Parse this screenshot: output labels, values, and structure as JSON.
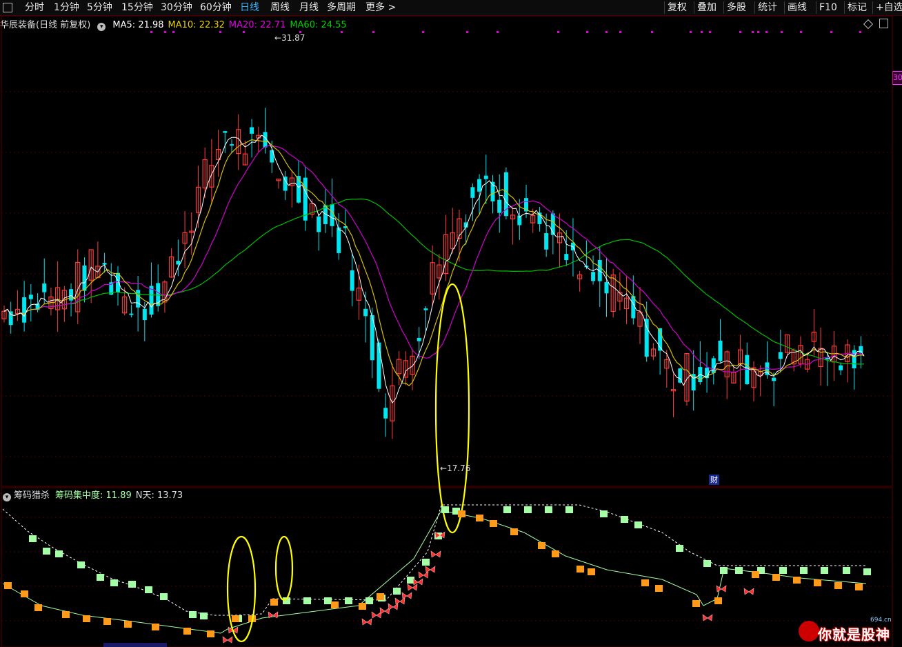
{
  "toolbar": {
    "left_items": [
      {
        "label": "分时",
        "active": false
      },
      {
        "label": "1分钟",
        "active": false
      },
      {
        "label": "5分钟",
        "active": false
      },
      {
        "label": "15分钟",
        "active": false
      },
      {
        "label": "30分钟",
        "active": false
      },
      {
        "label": "60分钟",
        "active": false
      },
      {
        "label": "日线",
        "active": true
      },
      {
        "label": "周线",
        "active": false
      },
      {
        "label": "月线",
        "active": false
      },
      {
        "label": "多周期",
        "active": false
      },
      {
        "label": "更多 >",
        "active": false
      }
    ],
    "right_items": [
      "复权",
      "叠加",
      "多股",
      "统计",
      "画线",
      "F10",
      "标记",
      "+自选"
    ]
  },
  "main_chart": {
    "stock_name": "华辰装备(日线 前复权)",
    "indicators": [
      {
        "label": "MA5: 21.98",
        "color": "#ffffff"
      },
      {
        "label": "MA10: 22.32",
        "color": "#e8d000"
      },
      {
        "label": "MA20: 22.71",
        "color": "#e000e0"
      },
      {
        "label": "MA60: 24.55",
        "color": "#00d000"
      }
    ],
    "high_label": "31.87",
    "low_label": "17.76",
    "price_tag": "30",
    "event_badge": "财",
    "colors": {
      "up": "#ff3b3b",
      "down": "#00e6f0",
      "ma5": "#ffffff",
      "ma10": "#d8c000",
      "ma20": "#d000d0",
      "ma60": "#00c000"
    }
  },
  "sub_chart": {
    "title": "筹码猎杀",
    "indicator_label": "筹码集中度: 11.89",
    "n_label": "N天: 13.73",
    "colors": {
      "green_block": "#a6ffa6",
      "orange_block": "#ff9a1a",
      "dotted": "#ffffff",
      "line": "#a6ffa6",
      "butterfly": "#ff3030"
    }
  },
  "watermark": {
    "text": "你就是股神",
    "url": "694.cn"
  }
}
